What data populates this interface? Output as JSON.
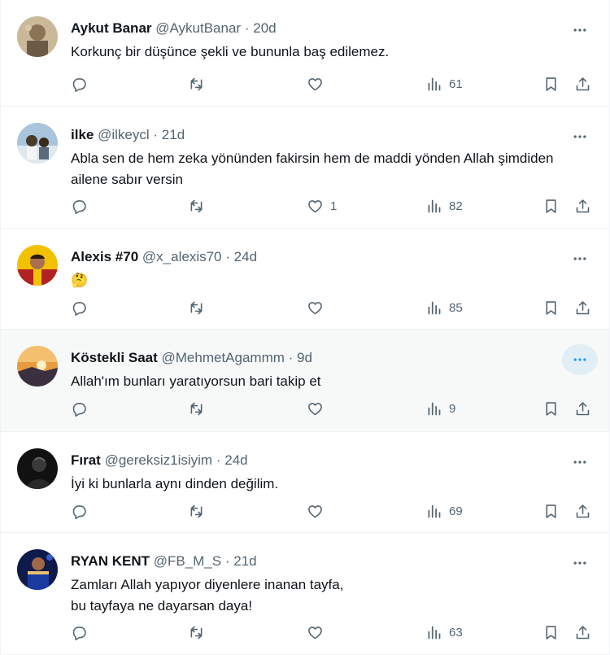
{
  "tweets": [
    {
      "name": "Aykut Banar",
      "handle": "@AykutBanar",
      "separator": "·",
      "time": "20d",
      "text": "Korkunç bir düşünce şekli ve bununla baş edilemez.",
      "likes": "",
      "views": "61",
      "avatar_colors": [
        "#8b7355",
        "#6b5a45"
      ]
    },
    {
      "name": "ilke",
      "handle": "@ilkeycl",
      "separator": "·",
      "time": "21d",
      "text": "Abla sen de hem zeka yönünden fakirsin hem de maddi yönden Allah şimdiden ailene sabır versin",
      "likes": "1",
      "views": "82",
      "avatar_colors": [
        "#a9c4dc",
        "#4a5a6a"
      ]
    },
    {
      "name": "Alexis #70",
      "handle": "@x_alexis70",
      "separator": "·",
      "time": "24d",
      "text": "🤔",
      "likes": "",
      "views": "85",
      "avatar_colors": [
        "#f2c200",
        "#b22222"
      ]
    },
    {
      "name": "Köstekli Saat",
      "handle": "@MehmetAgammm",
      "separator": "·",
      "time": "9d",
      "text": "Allah'ım bunları yaratıyorsun bari takip et",
      "likes": "",
      "views": "9",
      "avatar_colors": [
        "#f0a040",
        "#3a3a4a"
      ]
    },
    {
      "name": "Fırat",
      "handle": "@gereksiz1isiyim",
      "separator": "·",
      "time": "24d",
      "text": "İyi ki bunlarla aynı dinden değilim.",
      "likes": "",
      "views": "69",
      "avatar_colors": [
        "#222222",
        "#555555"
      ]
    },
    {
      "name": "RYAN KENT",
      "handle": "@FB_M_S",
      "separator": "·",
      "time": "21d",
      "text": "Zamları Allah yapıyor diyenlere inanan tayfa,\nbu tayfaya ne dayarsan daya!",
      "likes": "",
      "views": "63",
      "avatar_colors": [
        "#1a2a6c",
        "#e8c070"
      ]
    }
  ],
  "colors": {
    "text_primary": "#0f1419",
    "text_secondary": "#536471",
    "border": "#eff3f4",
    "hover_bg": "#f7f9f9",
    "accent_hover": "#e1eef6",
    "accent": "#1d9bf0"
  },
  "icons": [
    "reply-icon",
    "retweet-icon",
    "like-icon",
    "views-icon",
    "bookmark-icon",
    "share-icon",
    "more-icon"
  ]
}
